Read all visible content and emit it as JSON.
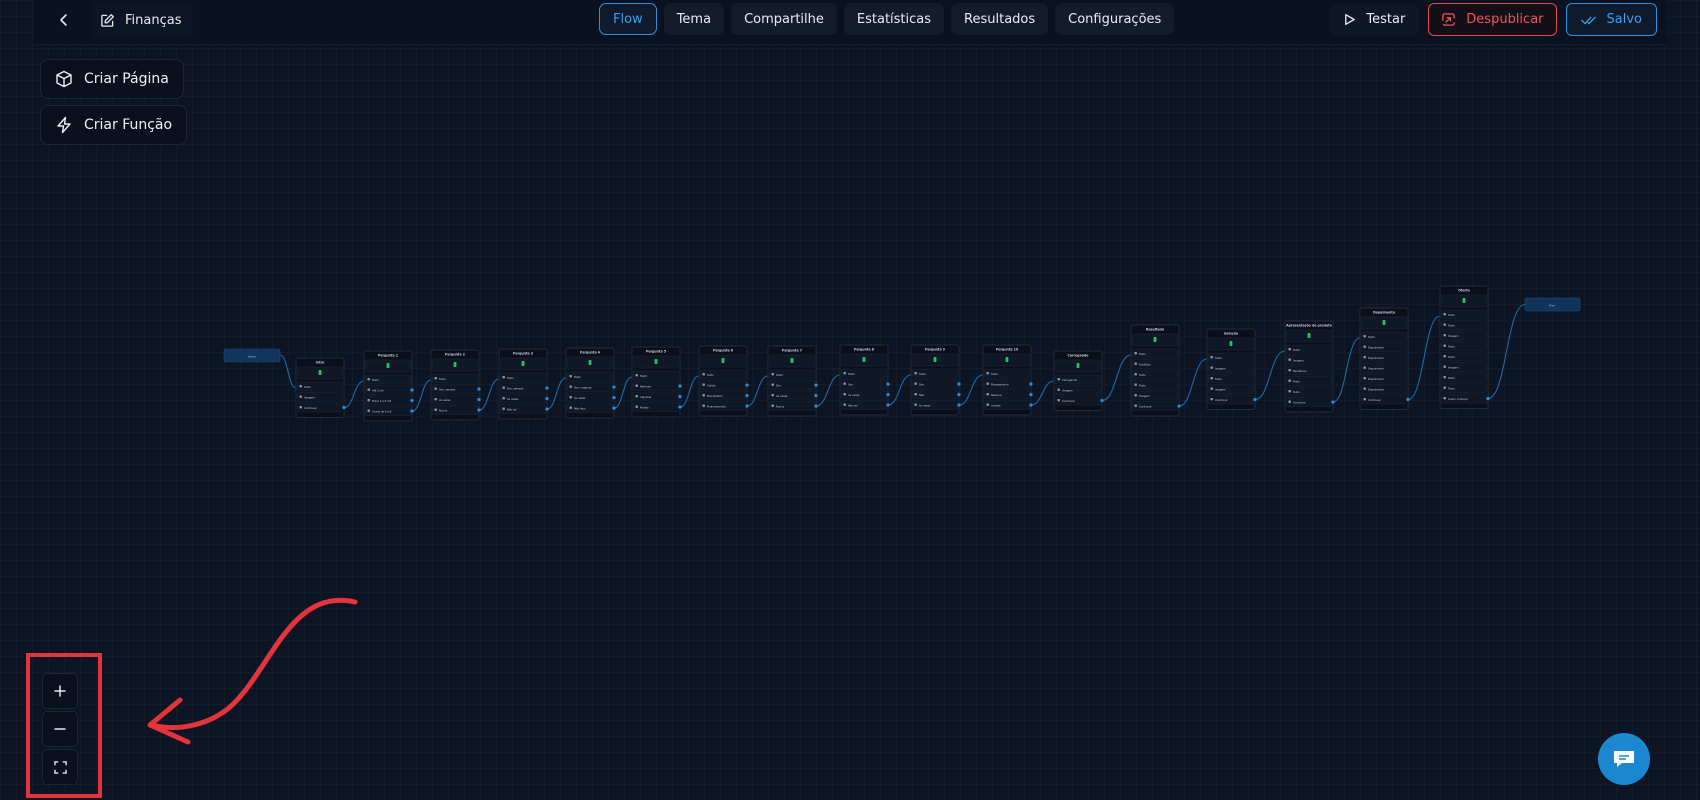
{
  "header": {
    "title": "Finanças",
    "tabs": [
      {
        "label": "Flow",
        "active": true
      },
      {
        "label": "Tema",
        "active": false
      },
      {
        "label": "Compartilhe",
        "active": false
      },
      {
        "label": "Estatísticas",
        "active": false
      },
      {
        "label": "Resultados",
        "active": false
      },
      {
        "label": "Configurações",
        "active": false
      }
    ],
    "test_label": "Testar",
    "unpublish_label": "Despublicar",
    "saved_label": "Salvo"
  },
  "toolbar": {
    "create_page_label": "Criar Página",
    "create_function_label": "Criar Função"
  },
  "flow": {
    "start_label": "Início",
    "end_label": "Fim",
    "nodes": [
      {
        "title": "Intro",
        "rows": [
          "Texto",
          "Imagem",
          "Continuar"
        ]
      },
      {
        "title": "Pergunta 1",
        "rows": [
          "Texto",
          "Até 3 mil",
          "Entre 3 e 6 mil",
          "Acima de 6 mil"
        ]
      },
      {
        "title": "Pergunta 2",
        "rows": [
          "Texto",
          "Sim, sempre",
          "Às vezes",
          "Nunca"
        ]
      },
      {
        "title": "Pergunta 3",
        "rows": [
          "Texto",
          "Sim, sempre",
          "Às vezes",
          "Não sei"
        ]
      },
      {
        "title": "Pergunta 4",
        "rows": [
          "Texto",
          "Sim, organizo",
          "Às vezes",
          "Não faço"
        ]
      },
      {
        "title": "Pergunta 5",
        "rows": [
          "Texto",
          "Nenhum",
          "Algumas",
          "Muitas"
        ]
      },
      {
        "title": "Pergunta 6",
        "rows": [
          "Texto",
          "Cartão",
          "Empréstimo",
          "Financiamento"
        ]
      },
      {
        "title": "Pergunta 7",
        "rows": [
          "Texto",
          "Sim",
          "Às vezes",
          "Nunca"
        ]
      },
      {
        "title": "Pergunta 8",
        "rows": [
          "Texto",
          "Sim",
          "Às vezes",
          "Não sei"
        ]
      },
      {
        "title": "Pergunta 9",
        "rows": [
          "Texto",
          "Sim",
          "Não",
          "Às vezes"
        ]
      },
      {
        "title": "Pergunta 10",
        "rows": [
          "Texto",
          "Planejamento",
          "Reserva",
          "Investir"
        ]
      },
      {
        "title": "Carregando",
        "rows": [
          "Carregando",
          "Imagem",
          "Continuar"
        ]
      },
      {
        "title": "Resultado",
        "rows": [
          "Texto",
          "Subtítulo",
          "Texto",
          "Texto",
          "Imagem",
          "Continuar"
        ]
      },
      {
        "title": "Solução",
        "rows": [
          "Texto",
          "Imagem",
          "Texto",
          "Imagem",
          "Continuar"
        ]
      },
      {
        "title": "Apresentação do produto",
        "rows": [
          "Texto",
          "Imagem",
          "Benefícios",
          "Texto",
          "Texto",
          "Continuar"
        ]
      },
      {
        "title": "Depoimento",
        "rows": [
          "Texto",
          "Depoimento",
          "Depoimento",
          "Depoimento",
          "Depoimento",
          "Depoimento",
          "Continuar"
        ]
      },
      {
        "title": "Oferta",
        "rows": [
          "Texto",
          "Texto",
          "Imagem",
          "Texto",
          "Texto",
          "Imagem",
          "Texto",
          "Texto",
          "Quero começar"
        ]
      }
    ]
  },
  "zoom": {
    "zoom_in_icon": "plus-icon",
    "zoom_out_icon": "minus-icon",
    "fit_icon": "fit-view-icon"
  },
  "colors": {
    "accent": "#2b8fe0",
    "danger": "#e5484d",
    "success": "#22c55e",
    "annotation": "#e3343b"
  }
}
